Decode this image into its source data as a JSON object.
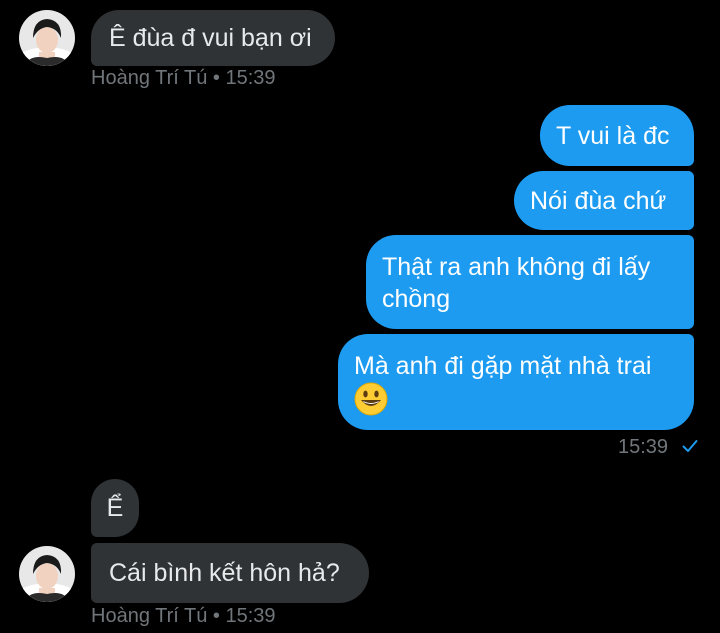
{
  "conversation": {
    "group1": {
      "messages": [
        "Ê đùa đ vui bạn ơi"
      ],
      "sender_name": "Hoàng Trí Tú",
      "separator": "•",
      "time": "15:39"
    },
    "outgoing": {
      "messages": [
        "T vui là đc",
        "Nói đùa chứ",
        "Thật ra anh không đi lấy chồng",
        "Mà anh đi gặp mặt nhà trai"
      ],
      "emoji": "grinning-face",
      "time": "15:39",
      "status": "sent-check-icon"
    },
    "group2": {
      "messages": [
        "Ể",
        "Cái bình kết hôn hả?"
      ],
      "sender_name": "Hoàng Trí Tú",
      "separator": "•",
      "time": "15:39"
    }
  },
  "colors": {
    "background": "#000000",
    "incoming_bubble": "#2f3336",
    "outgoing_bubble": "#1d9bf0",
    "meta_text": "#71767b",
    "check": "#1d9bf0"
  }
}
